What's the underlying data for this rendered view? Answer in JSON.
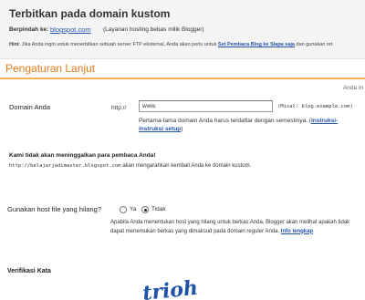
{
  "header": {
    "title": "Terbitkan pada domain kustom",
    "switch_label": "Berpindah ke:",
    "switch_link": "blogspot.com",
    "switch_note": "(Layanan hosting bebas milik Blogger)",
    "hint_label": "Hint",
    "hint_text": ": Jika Anda ingin untuk menerbitkan sebuah server FTP eksternal, Anda akan perlu untuk",
    "hint_link": "Set Pembaca Blog ke Siapa saja",
    "hint_tail": " dan gunakan ret"
  },
  "advanced": {
    "title": "Pengaturan Lanjut",
    "lang_corner": "Anda in"
  },
  "domain": {
    "label": "Domain Anda",
    "prefix": "http://",
    "value": "www.",
    "example": "(Misal: blog.example.com)",
    "note": "Pertama-tama domain Anda harus terdaftar dengan semestinya. (",
    "note_link": "instruksi-instruksi setup",
    "note_end": ")"
  },
  "keep_readers": {
    "title": "Kami tidak akan meninggalkan para pembaca Anda!",
    "url": "http://belajarjadimaster.blogspot.com",
    "text": " akan mengarahkan kembali Anda ke domain kustom."
  },
  "hosts": {
    "label": "Gunakan host file yang hilang?",
    "option_yes": "Ya",
    "option_no": "Tidak",
    "selected": "Tidak",
    "note": "Apabila Anda menentukan host yang hilang untuk berkas Anda, Blogger akan melihat apakah tidak dapat menemukan berkas yang dimaksud pada domain reguler Anda. ",
    "note_link": "Info lengkap"
  },
  "verify": {
    "label": "Verifikasi Kata",
    "captcha_word": "trioh"
  },
  "colors": {
    "accent": "#e07b1c",
    "rule": "#f3b15c",
    "link": "#2255aa",
    "captcha": "#1e52a6"
  }
}
